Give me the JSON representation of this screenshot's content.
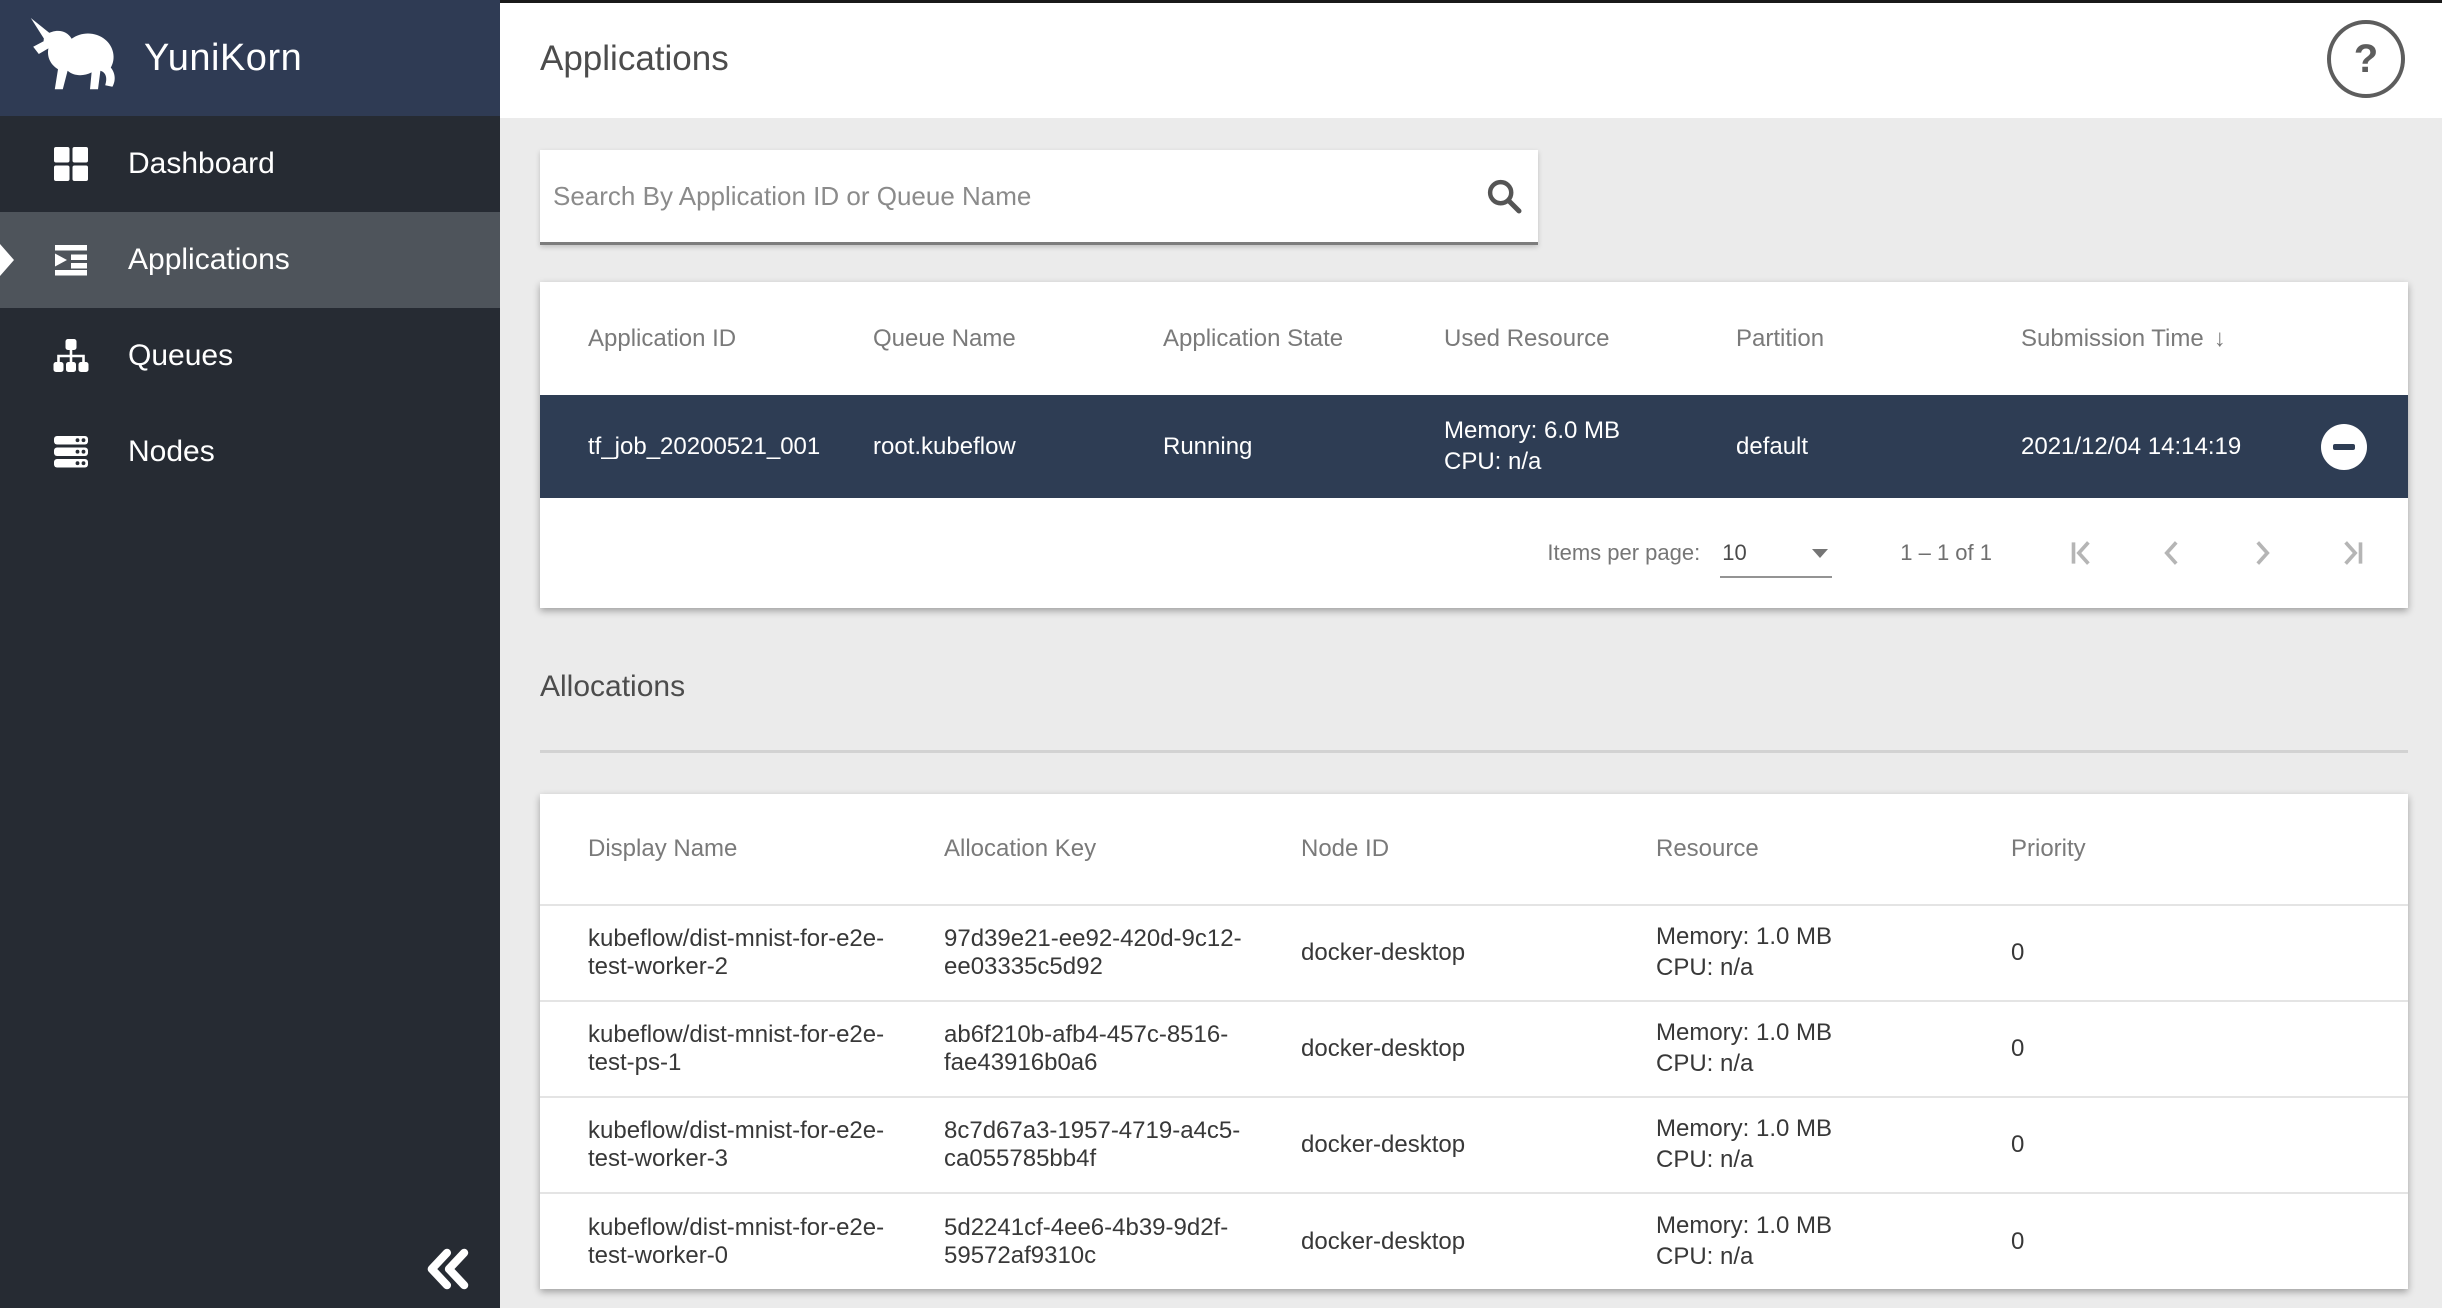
{
  "app": {
    "title": "YuniKorn"
  },
  "colors": {
    "sidebar_bg": "#262b33",
    "sidebar_header_bg": "#2f3b54",
    "sidebar_active_bg": "#4e545b",
    "selected_row_bg": "#2e3d54",
    "content_bg": "#ebebeb",
    "header_text": "#7a7a7a"
  },
  "sidebar": {
    "items": [
      {
        "label": "Dashboard"
      },
      {
        "label": "Applications",
        "active": true
      },
      {
        "label": "Queues"
      },
      {
        "label": "Nodes"
      }
    ]
  },
  "header": {
    "title": "Applications",
    "help_label": "?"
  },
  "search": {
    "placeholder": "Search By Application ID or Queue Name",
    "value": ""
  },
  "applications_table": {
    "columns": [
      "Application ID",
      "Queue Name",
      "Application State",
      "Used Resource",
      "Partition",
      "Submission Time"
    ],
    "sort_column": "Submission Time",
    "sort_direction": "desc",
    "sort_arrow": "↓",
    "rows": [
      {
        "application_id": "tf_job_20200521_001",
        "queue_name": "root.kubeflow",
        "application_state": "Running",
        "used_resource": {
          "memory": "Memory: 6.0 MB",
          "cpu": "CPU: n/a"
        },
        "partition": "default",
        "submission_time": "2021/12/04 14:14:19",
        "selected": true
      }
    ],
    "paginator": {
      "items_per_page_label": "Items per page:",
      "items_per_page_value": "10",
      "range_label": "1 – 1 of 1"
    }
  },
  "allocations": {
    "heading": "Allocations",
    "columns": [
      "Display Name",
      "Allocation Key",
      "Node ID",
      "Resource",
      "Priority"
    ],
    "rows": [
      {
        "display_name": "kubeflow/dist-mnist-for-e2e-test-worker-2",
        "allocation_key": "97d39e21-ee92-420d-9c12-ee03335c5d92",
        "node_id": "docker-desktop",
        "resource": {
          "memory": "Memory: 1.0 MB",
          "cpu": "CPU: n/a"
        },
        "priority": "0"
      },
      {
        "display_name": "kubeflow/dist-mnist-for-e2e-test-ps-1",
        "allocation_key": "ab6f210b-afb4-457c-8516-fae43916b0a6",
        "node_id": "docker-desktop",
        "resource": {
          "memory": "Memory: 1.0 MB",
          "cpu": "CPU: n/a"
        },
        "priority": "0"
      },
      {
        "display_name": "kubeflow/dist-mnist-for-e2e-test-worker-3",
        "allocation_key": "8c7d67a3-1957-4719-a4c5-ca055785bb4f",
        "node_id": "docker-desktop",
        "resource": {
          "memory": "Memory: 1.0 MB",
          "cpu": "CPU: n/a"
        },
        "priority": "0"
      },
      {
        "display_name": "kubeflow/dist-mnist-for-e2e-test-worker-0",
        "allocation_key": "5d2241cf-4ee6-4b39-9d2f-59572af9310c",
        "node_id": "docker-desktop",
        "resource": {
          "memory": "Memory: 1.0 MB",
          "cpu": "CPU: n/a"
        },
        "priority": "0"
      }
    ]
  }
}
